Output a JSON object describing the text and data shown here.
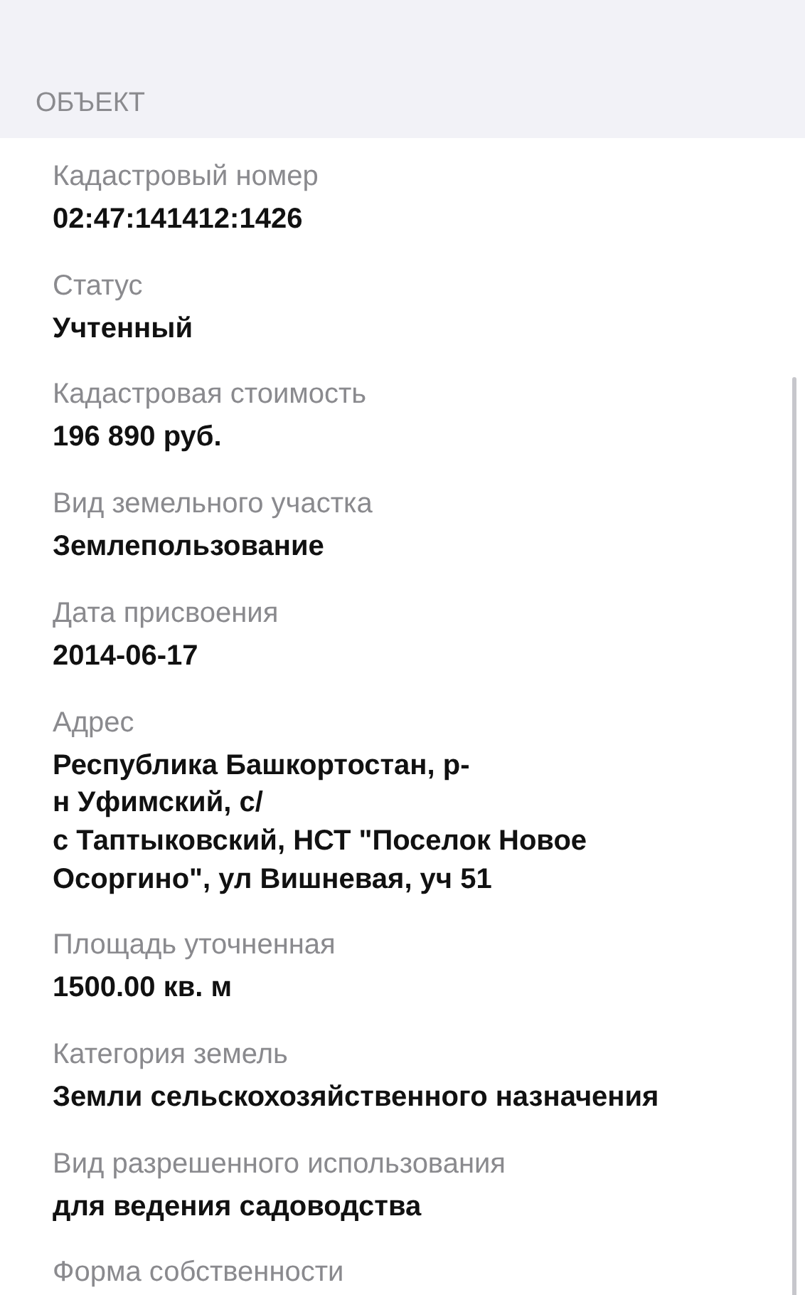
{
  "section": {
    "title": "ОБЪЕКТ"
  },
  "fields": [
    {
      "label": "Кадастровый номер",
      "value": "02:47:141412:1426"
    },
    {
      "label": "Статус",
      "value": "Учтенный"
    },
    {
      "label": "Кадастровая стоимость",
      "value": "196 890 руб."
    },
    {
      "label": "Вид земельного участка",
      "value": "Землепользование"
    },
    {
      "label": "Дата присвоения",
      "value": "2014-06-17"
    },
    {
      "label": "Адрес",
      "value": "Республика Башкортостан, р-\nн Уфимский, с/\nс Таптыковский, НСТ \"Поселок Новое\nОсоргино\", ул Вишневая, уч 51"
    },
    {
      "label": "Площадь уточненная",
      "value": "1500.00 кв. м"
    },
    {
      "label": "Категория земель",
      "value": "Земли сельскохозяйственного назначения"
    },
    {
      "label": "Вид разрешенного использования",
      "value": "для ведения садоводства"
    },
    {
      "label": "Форма собственности"
    }
  ]
}
